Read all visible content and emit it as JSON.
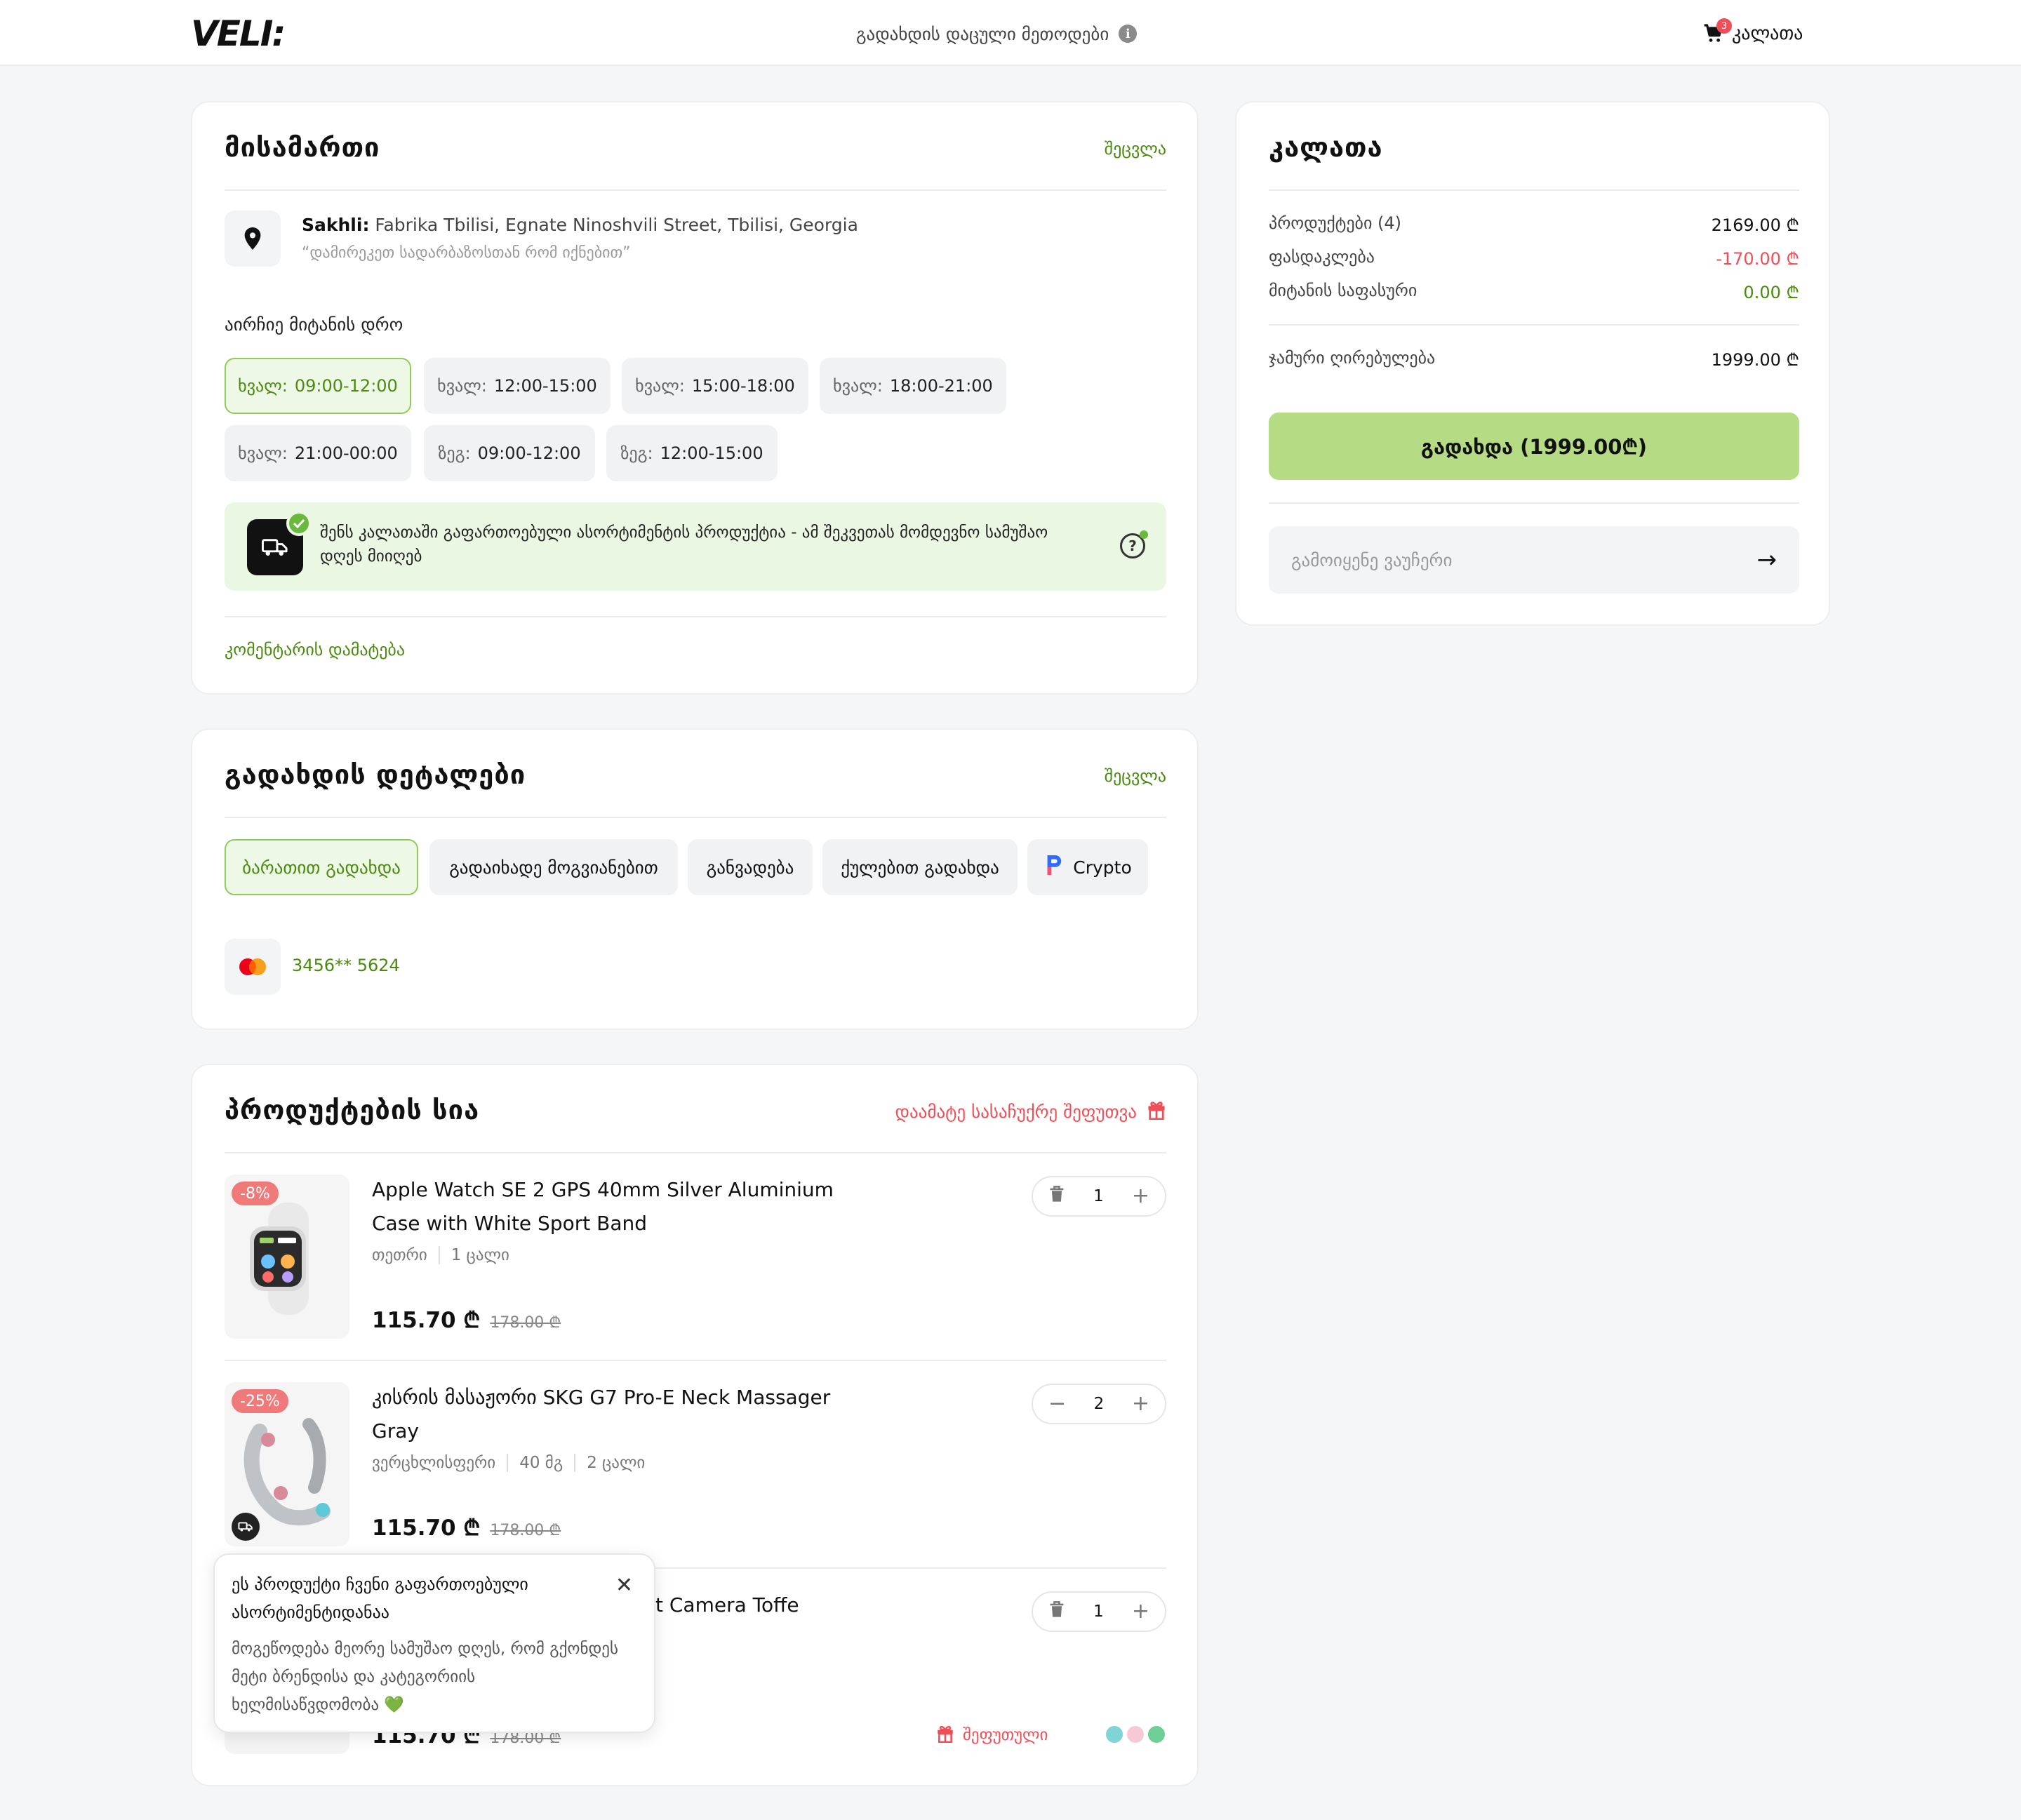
{
  "header": {
    "logo": "VELI:",
    "secure_methods": "გადახდის დაცული მეთოდები",
    "info_icon": "i",
    "cart_label": "კალათა",
    "cart_count": "3"
  },
  "address": {
    "title": "მისამართი",
    "change": "შეცვლა",
    "label": "Sakhli:",
    "street": " Fabrika Tbilisi, Egnate Ninoshvili Street, Tbilisi, Georgia",
    "note": "“დამირეკეთ სადარბაზოსთან რომ იქნებით”",
    "time_label": "აირჩიე მიტანის დრო",
    "slots": [
      {
        "day": "ხვალ:",
        "time": "09:00-12:00"
      },
      {
        "day": "ხვალ:",
        "time": "12:00-15:00"
      },
      {
        "day": "ხვალ:",
        "time": "15:00-18:00"
      },
      {
        "day": "ხვალ:",
        "time": "18:00-21:00"
      },
      {
        "day": "ხვალ:",
        "time": "21:00-00:00"
      },
      {
        "day": "ზეგ:",
        "time": "09:00-12:00"
      },
      {
        "day": "ზეგ:",
        "time": "12:00-15:00"
      }
    ],
    "notice": "შენს კალათაში გაფართოებული ასორტიმენტის პროდუქტია - ამ შეკვეთას მომდევნო სამუშაო დღეს მიიღებ",
    "help_icon": "?",
    "add_comment": "კომენტარის დამატება"
  },
  "payment": {
    "title": "გადახდის დეტალები",
    "change": "შეცვლა",
    "methods": [
      "ბარათით გადახდა",
      "გადაიხადე მოგვიანებით",
      "განვადება",
      "ქულებით გადახდა",
      "Crypto"
    ],
    "card_number": "3456** 5624"
  },
  "products": {
    "title": "პროდუქტების სია",
    "gift_link": "დაამატე სასაჩუქრე შეფუთვა",
    "items": [
      {
        "discount": "-8%",
        "title": "Apple Watch SE 2 GPS 40mm Silver Aluminium Case with White Sport Band",
        "meta": [
          "თეთრი",
          "1 ცალი"
        ],
        "price": "115.70 ₾",
        "old_price": "178.00 ₾",
        "qty": "1"
      },
      {
        "discount": "-25%",
        "title": "კისრის მასაჟორი SKG G7 Pro-E Neck Massager Gray",
        "meta": [
          "ვერცხლისფერი",
          "40 მგ",
          "2 ცალი"
        ],
        "price": "115.70 ₾",
        "old_price": "178.00 ₾",
        "qty": "2"
      },
      {
        "title_fragment": "t Camera Toffe",
        "price": "115.70 ₾",
        "old_price": "178.00 ₾",
        "qty": "1",
        "packed": "შეფუთული"
      }
    ],
    "tooltip": {
      "title": "ეს პროდუქტი ჩვენი გაფართოებული ასორტიმენტიდანაა",
      "body": "მოგეწოდება მეორე სამუშაო დღეს, რომ გქონდეს მეტი ბრენდისა და კატეგორიის ხელმისაწვდომობა 💚",
      "close": "✕"
    }
  },
  "cart": {
    "title": "კალათა",
    "rows": [
      {
        "label": "პროდუქტები (4)",
        "value": "2169.00 ₾"
      },
      {
        "label": "ფასდაკლება",
        "value": "-170.00 ₾"
      },
      {
        "label": "მიტანის საფასური",
        "value": "0.00 ₾"
      }
    ],
    "total_label": "ჯამური ღირებულება",
    "total_value": "1999.00 ₾",
    "pay_button": "გადახდა (1999.00₾)",
    "voucher_placeholder": "გამოიყენე ვაუჩერი",
    "voucher_arrow": "→"
  },
  "colors": {
    "accent_green": "#4a8a0e",
    "button_green": "#b5dc84",
    "discount_red": "#ef4e56"
  }
}
